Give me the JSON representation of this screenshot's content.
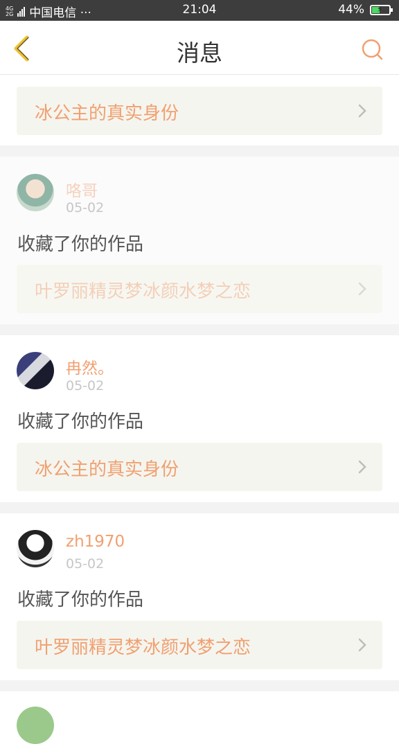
{
  "status_bar": {
    "network": "4G",
    "network2": "2G",
    "carrier": "中国电信 ···",
    "time": "21:04",
    "battery": "44%"
  },
  "header": {
    "title": "消息",
    "back_icon": "chevron-left-icon",
    "search_icon": "search-icon"
  },
  "top_link": {
    "label": "冰公主的真实身份"
  },
  "messages": [
    {
      "user": "咯哥",
      "date": "05-02",
      "action": "收藏了你的作品",
      "work": "叶罗丽精灵梦冰颜水梦之恋",
      "faded": true
    },
    {
      "user": "冉然。",
      "date": "05-02",
      "action": "收藏了你的作品",
      "work": "冰公主的真实身份",
      "faded": false
    },
    {
      "user": "zh1970",
      "date": "05-02",
      "action": "收藏了你的作品",
      "work": "叶罗丽精灵梦冰颜水梦之恋",
      "faded": false
    }
  ],
  "colors": {
    "accent": "#f0a070",
    "link_bg": "#f5f5ef",
    "separator": "#f3f3f3",
    "status_bar": "#3d3d3d"
  }
}
